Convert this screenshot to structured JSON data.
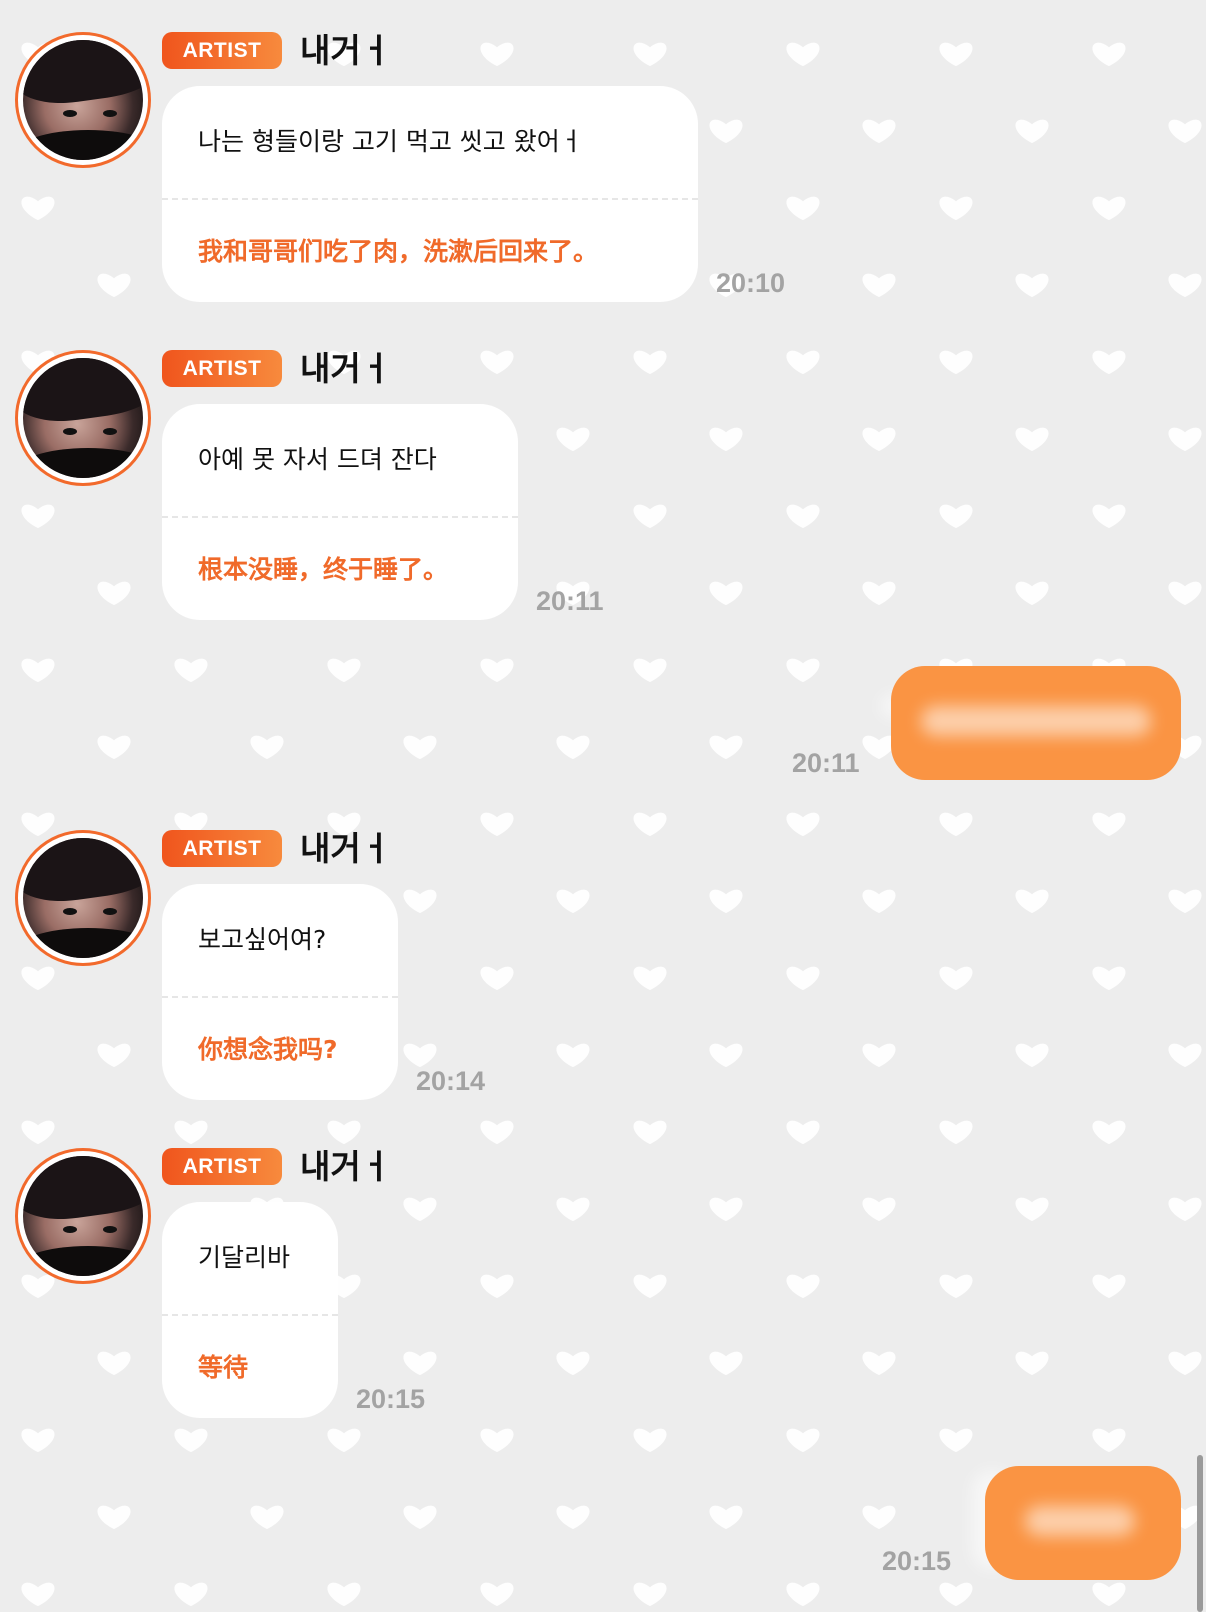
{
  "colors": {
    "background": "#ededed",
    "accent": "#f26a2c",
    "my_bubble": "#fa9443",
    "translation_text": "#f06a2a",
    "timestamp": "#a3a3a3"
  },
  "messages": [
    {
      "badge": "ARTIST",
      "sender": "내거ㅓ",
      "korean": "나는 형들이랑 고기 먹고 씻고 왔어ㅓ",
      "chinese": "我和哥哥们吃了肉，洗漱后回来了。",
      "time": "20:10"
    },
    {
      "badge": "ARTIST",
      "sender": "내거ㅓ",
      "korean": "아예 못 자서 드뎌 잔다",
      "chinese": "根本没睡，终于睡了。",
      "time": "20:11"
    },
    {
      "badge": "ARTIST",
      "sender": "내거ㅓ",
      "korean": "보고싶어여?",
      "chinese": "你想念我吗?",
      "time": "20:14"
    },
    {
      "badge": "ARTIST",
      "sender": "내거ㅓ",
      "korean": "기달리바",
      "chinese": "等待",
      "time": "20:15"
    }
  ],
  "my_messages": [
    {
      "time": "20:11"
    },
    {
      "time": "20:15"
    }
  ],
  "icons": {
    "background_pattern": "heart-icon",
    "avatar": "artist-avatar"
  }
}
